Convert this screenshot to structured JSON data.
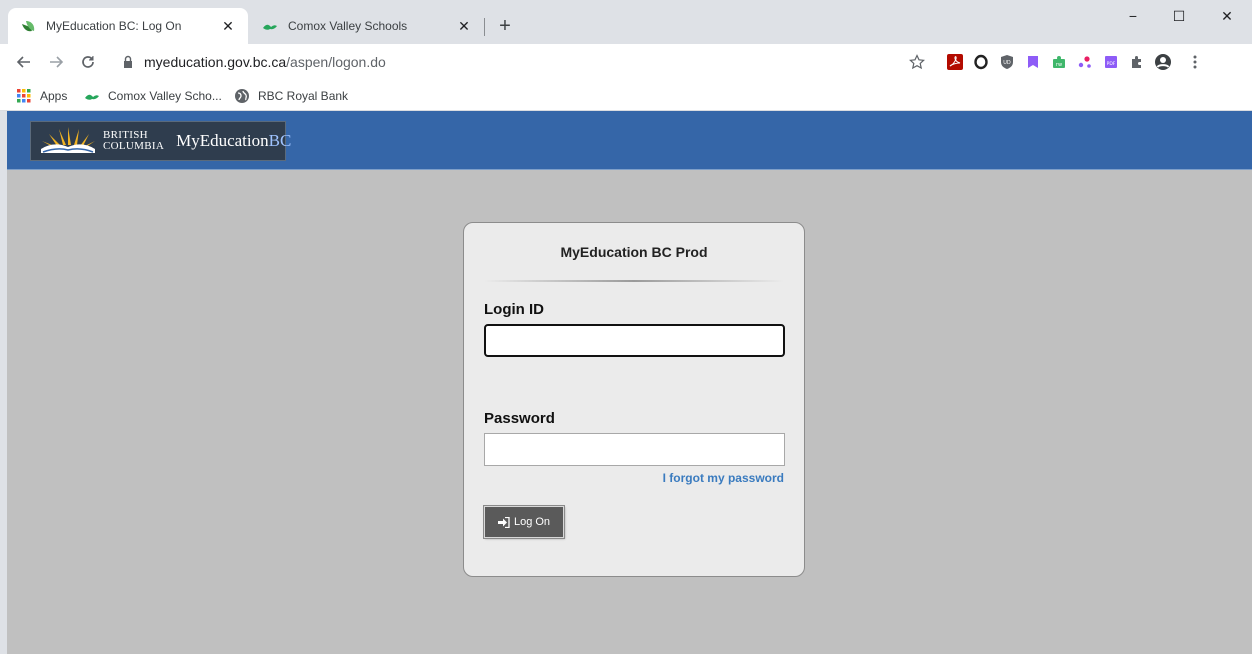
{
  "tabs": [
    {
      "title": "MyEducation BC: Log On",
      "active": true
    },
    {
      "title": "Comox Valley Schools",
      "active": false
    }
  ],
  "window_controls": {
    "minimize": "−",
    "maximize": "☐",
    "close": "✕"
  },
  "toolbar": {
    "url_host": "myeducation.gov.bc.ca",
    "url_path": "/aspen/logon.do"
  },
  "bookmarks": [
    {
      "label": "Apps",
      "icon": "apps-grid-icon"
    },
    {
      "label": "Comox Valley Scho...",
      "icon": "comox-favicon"
    },
    {
      "label": "RBC Royal Bank",
      "icon": "globe-icon"
    }
  ],
  "header": {
    "logo_line1": "British",
    "logo_line2": "Columbia",
    "app_name": "MyEducation",
    "app_accent": "BC"
  },
  "login": {
    "title": "MyEducation BC Prod",
    "login_label": "Login ID",
    "login_value": "",
    "password_label": "Password",
    "password_value": "",
    "forgot_link": "I forgot my password",
    "logon_button": "Log On"
  },
  "colors": {
    "header_bg": "#3566a8",
    "page_bg": "#c0c0c0",
    "card_bg": "#ebebeb",
    "link": "#3a7bbf",
    "button_bg": "#5a5a5a"
  }
}
